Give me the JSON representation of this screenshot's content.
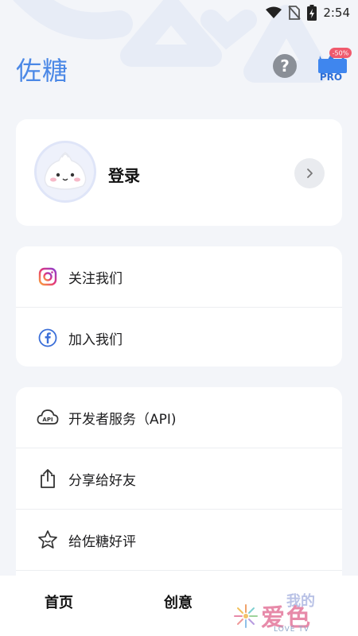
{
  "status_bar": {
    "time": "2:54"
  },
  "header": {
    "app_title": "佐糖",
    "help_symbol": "?",
    "pro_label": "PRO",
    "pro_discount": "-50%"
  },
  "login": {
    "label": "登录"
  },
  "social": [
    {
      "label": "关注我们",
      "icon": "instagram-icon"
    },
    {
      "label": "加入我们",
      "icon": "facebook-icon"
    }
  ],
  "menu": [
    {
      "label": "开发者服务（API)",
      "icon": "api-cloud-icon"
    },
    {
      "label": "分享给好友",
      "icon": "share-icon"
    },
    {
      "label": "给佐糖好评",
      "icon": "star-icon"
    }
  ],
  "bottom_nav": {
    "home": "首页",
    "create": "创意",
    "mine": "我的"
  },
  "watermark": {
    "text": "爱色",
    "sub": "LOVE TV"
  },
  "colors": {
    "accent": "#4b88e6",
    "background": "#f3f5f9"
  }
}
